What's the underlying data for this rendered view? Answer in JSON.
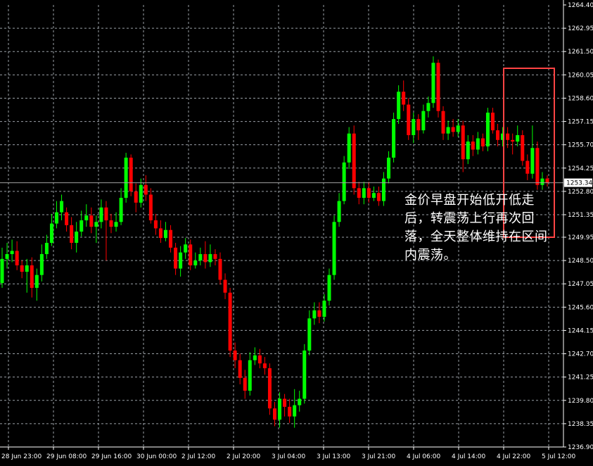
{
  "colors": {
    "background": "#000000",
    "grid": "#9aa0a6",
    "bull": "#00ff00",
    "bear": "#ff0000",
    "axis": "#ffffff",
    "highlight_box": "#ff4444",
    "price_line": "#a0a0a0"
  },
  "annotation": {
    "text": "金价早盘开始低开低走后，转震荡上行再次回落，全天整体维持在区间内震荡。"
  },
  "chart_data": {
    "type": "candlestick",
    "title": "",
    "xlabel": "",
    "ylabel": "",
    "ylim": [
      1236.9,
      1264.4
    ],
    "yticks": [
      "1264.40",
      "1262.95",
      "1261.50",
      "1260.05",
      "1258.60",
      "1257.15",
      "1255.70",
      "1254.25",
      "1252.80",
      "1251.35",
      "1249.95",
      "1248.50",
      "1247.05",
      "1245.60",
      "1244.15",
      "1242.70",
      "1241.25",
      "1239.80",
      "1238.35",
      "1236.90"
    ],
    "xticks": [
      "28 Jun 23:00",
      "29 Jun 08:00",
      "29 Jun 16:00",
      "30 Jun 00:00",
      "2 Jul 12:00",
      "2 Jul 20:00",
      "3 Jul 04:00",
      "3 Jul 13:00",
      "3 Jul 21:00",
      "4 Jul 06:00",
      "4 Jul 14:00",
      "4 Jul 22:00",
      "5 Jul 12:00"
    ],
    "current_price": "1253.34",
    "candles": [
      [
        1247.1,
        1248.6,
        1249.3,
        1246.8
      ],
      [
        1248.6,
        1248.9,
        1249.6,
        1248.0
      ],
      [
        1248.9,
        1249.1,
        1249.8,
        1248.4
      ],
      [
        1249.1,
        1248.2,
        1249.7,
        1247.9
      ],
      [
        1248.2,
        1247.8,
        1248.5,
        1247.4
      ],
      [
        1247.8,
        1248.2,
        1248.6,
        1246.5
      ],
      [
        1248.2,
        1246.8,
        1248.7,
        1246.2
      ],
      [
        1246.8,
        1247.6,
        1248.0,
        1246.0
      ],
      [
        1247.6,
        1248.9,
        1249.5,
        1247.2
      ],
      [
        1248.9,
        1249.6,
        1250.1,
        1248.6
      ],
      [
        1249.6,
        1250.8,
        1251.4,
        1249.4
      ],
      [
        1250.8,
        1251.5,
        1252.2,
        1250.5
      ],
      [
        1251.5,
        1252.2,
        1252.6,
        1251.0
      ],
      [
        1251.5,
        1250.7,
        1251.8,
        1250.3
      ],
      [
        1250.7,
        1249.6,
        1251.2,
        1249.2
      ],
      [
        1249.6,
        1250.3,
        1250.9,
        1249.0
      ],
      [
        1250.3,
        1251.0,
        1251.6,
        1250.0
      ],
      [
        1251.0,
        1251.3,
        1252.0,
        1250.6
      ],
      [
        1251.3,
        1250.6,
        1251.8,
        1250.2
      ],
      [
        1250.6,
        1250.9,
        1251.3,
        1249.6
      ],
      [
        1250.9,
        1251.8,
        1252.3,
        1250.5
      ],
      [
        1251.8,
        1251.0,
        1252.2,
        1248.5
      ],
      [
        1251.0,
        1250.6,
        1251.4,
        1250.2
      ],
      [
        1250.6,
        1250.9,
        1251.5,
        1250.3
      ],
      [
        1250.9,
        1252.4,
        1253.0,
        1250.7
      ],
      [
        1252.4,
        1254.9,
        1255.2,
        1252.1
      ],
      [
        1254.9,
        1252.8,
        1255.1,
        1252.5
      ],
      [
        1252.8,
        1252.1,
        1253.3,
        1251.5
      ],
      [
        1252.1,
        1253.2,
        1253.6,
        1251.8
      ],
      [
        1253.2,
        1252.6,
        1253.8,
        1252.2
      ],
      [
        1252.6,
        1251.0,
        1253.0,
        1250.8
      ],
      [
        1251.0,
        1250.5,
        1251.4,
        1250.1
      ],
      [
        1250.5,
        1249.9,
        1251.0,
        1249.6
      ],
      [
        1249.9,
        1250.4,
        1250.9,
        1249.7
      ],
      [
        1250.4,
        1249.3,
        1250.7,
        1249.0
      ],
      [
        1249.3,
        1248.0,
        1249.6,
        1247.6
      ],
      [
        1248.0,
        1249.0,
        1249.4,
        1247.5
      ],
      [
        1249.0,
        1249.5,
        1249.9,
        1248.6
      ],
      [
        1249.5,
        1248.2,
        1249.8,
        1247.9
      ],
      [
        1248.2,
        1248.5,
        1249.0,
        1248.0
      ],
      [
        1248.5,
        1248.9,
        1249.3,
        1248.2
      ],
      [
        1248.9,
        1248.4,
        1249.7,
        1248.0
      ],
      [
        1248.4,
        1248.9,
        1249.5,
        1248.1
      ],
      [
        1248.9,
        1248.6,
        1249.2,
        1248.2
      ],
      [
        1248.6,
        1247.3,
        1249.0,
        1247.0
      ],
      [
        1247.3,
        1246.5,
        1247.7,
        1246.1
      ],
      [
        1246.5,
        1242.9,
        1246.8,
        1242.5
      ],
      [
        1242.9,
        1242.3,
        1243.4,
        1241.8
      ],
      [
        1242.3,
        1241.2,
        1242.7,
        1240.8
      ],
      [
        1241.2,
        1240.4,
        1241.7,
        1239.9
      ],
      [
        1240.4,
        1242.3,
        1242.8,
        1240.1
      ],
      [
        1242.3,
        1242.6,
        1243.1,
        1242.0
      ],
      [
        1242.6,
        1242.1,
        1243.0,
        1241.8
      ],
      [
        1242.1,
        1241.8,
        1242.5,
        1241.4
      ],
      [
        1241.8,
        1239.3,
        1242.1,
        1238.9
      ],
      [
        1239.3,
        1238.6,
        1239.7,
        1238.2
      ],
      [
        1238.6,
        1239.9,
        1240.3,
        1238.1
      ],
      [
        1239.9,
        1239.4,
        1240.2,
        1238.8
      ],
      [
        1239.4,
        1238.8,
        1239.9,
        1238.4
      ],
      [
        1238.8,
        1239.5,
        1240.5,
        1238.1
      ],
      [
        1239.5,
        1239.9,
        1240.4,
        1239.1
      ],
      [
        1239.9,
        1242.9,
        1243.3,
        1239.6
      ],
      [
        1242.9,
        1244.9,
        1245.4,
        1242.6
      ],
      [
        1244.9,
        1245.4,
        1245.9,
        1244.5
      ],
      [
        1245.4,
        1245.0,
        1245.9,
        1244.6
      ],
      [
        1245.0,
        1246.0,
        1246.4,
        1244.7
      ],
      [
        1246.0,
        1247.6,
        1248.0,
        1245.7
      ],
      [
        1247.6,
        1250.9,
        1251.3,
        1247.3
      ],
      [
        1250.9,
        1252.2,
        1252.7,
        1250.6
      ],
      [
        1252.2,
        1254.6,
        1255.0,
        1252.0
      ],
      [
        1254.6,
        1256.4,
        1256.8,
        1254.2
      ],
      [
        1256.4,
        1253.0,
        1256.9,
        1252.6
      ],
      [
        1253.0,
        1252.4,
        1253.4,
        1252.0
      ],
      [
        1252.4,
        1253.0,
        1253.4,
        1252.0
      ],
      [
        1253.0,
        1252.4,
        1253.4,
        1252.1
      ],
      [
        1252.4,
        1252.7,
        1253.1,
        1252.2
      ],
      [
        1252.7,
        1252.2,
        1253.1,
        1251.9
      ],
      [
        1252.2,
        1253.6,
        1254.0,
        1251.9
      ],
      [
        1253.6,
        1254.9,
        1255.3,
        1253.3
      ],
      [
        1254.9,
        1257.3,
        1257.7,
        1254.6
      ],
      [
        1257.3,
        1259.0,
        1259.4,
        1257.0
      ],
      [
        1259.0,
        1258.2,
        1259.7,
        1257.8
      ],
      [
        1258.2,
        1256.3,
        1258.6,
        1256.0
      ],
      [
        1256.3,
        1257.3,
        1257.7,
        1255.8
      ],
      [
        1257.3,
        1256.6,
        1257.6,
        1256.0
      ],
      [
        1256.6,
        1257.8,
        1258.2,
        1256.4
      ],
      [
        1257.8,
        1258.3,
        1258.7,
        1257.4
      ],
      [
        1258.3,
        1260.8,
        1261.2,
        1258.0
      ],
      [
        1260.8,
        1257.8,
        1261.0,
        1257.4
      ],
      [
        1257.8,
        1256.4,
        1258.1,
        1256.0
      ],
      [
        1256.4,
        1256.8,
        1257.2,
        1256.0
      ],
      [
        1256.8,
        1256.5,
        1257.3,
        1256.2
      ],
      [
        1256.5,
        1256.9,
        1257.3,
        1256.2
      ],
      [
        1256.9,
        1254.8,
        1257.2,
        1254.0
      ],
      [
        1254.8,
        1255.9,
        1256.3,
        1254.5
      ],
      [
        1255.9,
        1255.4,
        1256.3,
        1255.0
      ],
      [
        1255.4,
        1256.1,
        1256.5,
        1255.1
      ],
      [
        1256.1,
        1255.6,
        1256.4,
        1255.3
      ],
      [
        1255.6,
        1257.7,
        1258.0,
        1255.3
      ],
      [
        1257.7,
        1256.6,
        1258.0,
        1256.4
      ],
      [
        1256.6,
        1256.0,
        1257.0,
        1255.6
      ],
      [
        1256.0,
        1256.4,
        1256.8,
        1255.6
      ],
      [
        1256.4,
        1256.0,
        1256.8,
        1255.5
      ],
      [
        1256.0,
        1255.9,
        1256.4,
        1255.1
      ],
      [
        1255.9,
        1256.3,
        1256.9,
        1255.6
      ],
      [
        1256.3,
        1254.7,
        1256.6,
        1254.4
      ],
      [
        1254.7,
        1253.9,
        1255.1,
        1253.5
      ],
      [
        1253.9,
        1255.5,
        1256.9,
        1253.6
      ],
      [
        1255.5,
        1253.2,
        1255.9,
        1252.9
      ],
      [
        1253.2,
        1253.6,
        1254.0,
        1252.9
      ],
      [
        1253.6,
        1253.34,
        1253.8,
        1253.1
      ]
    ]
  }
}
